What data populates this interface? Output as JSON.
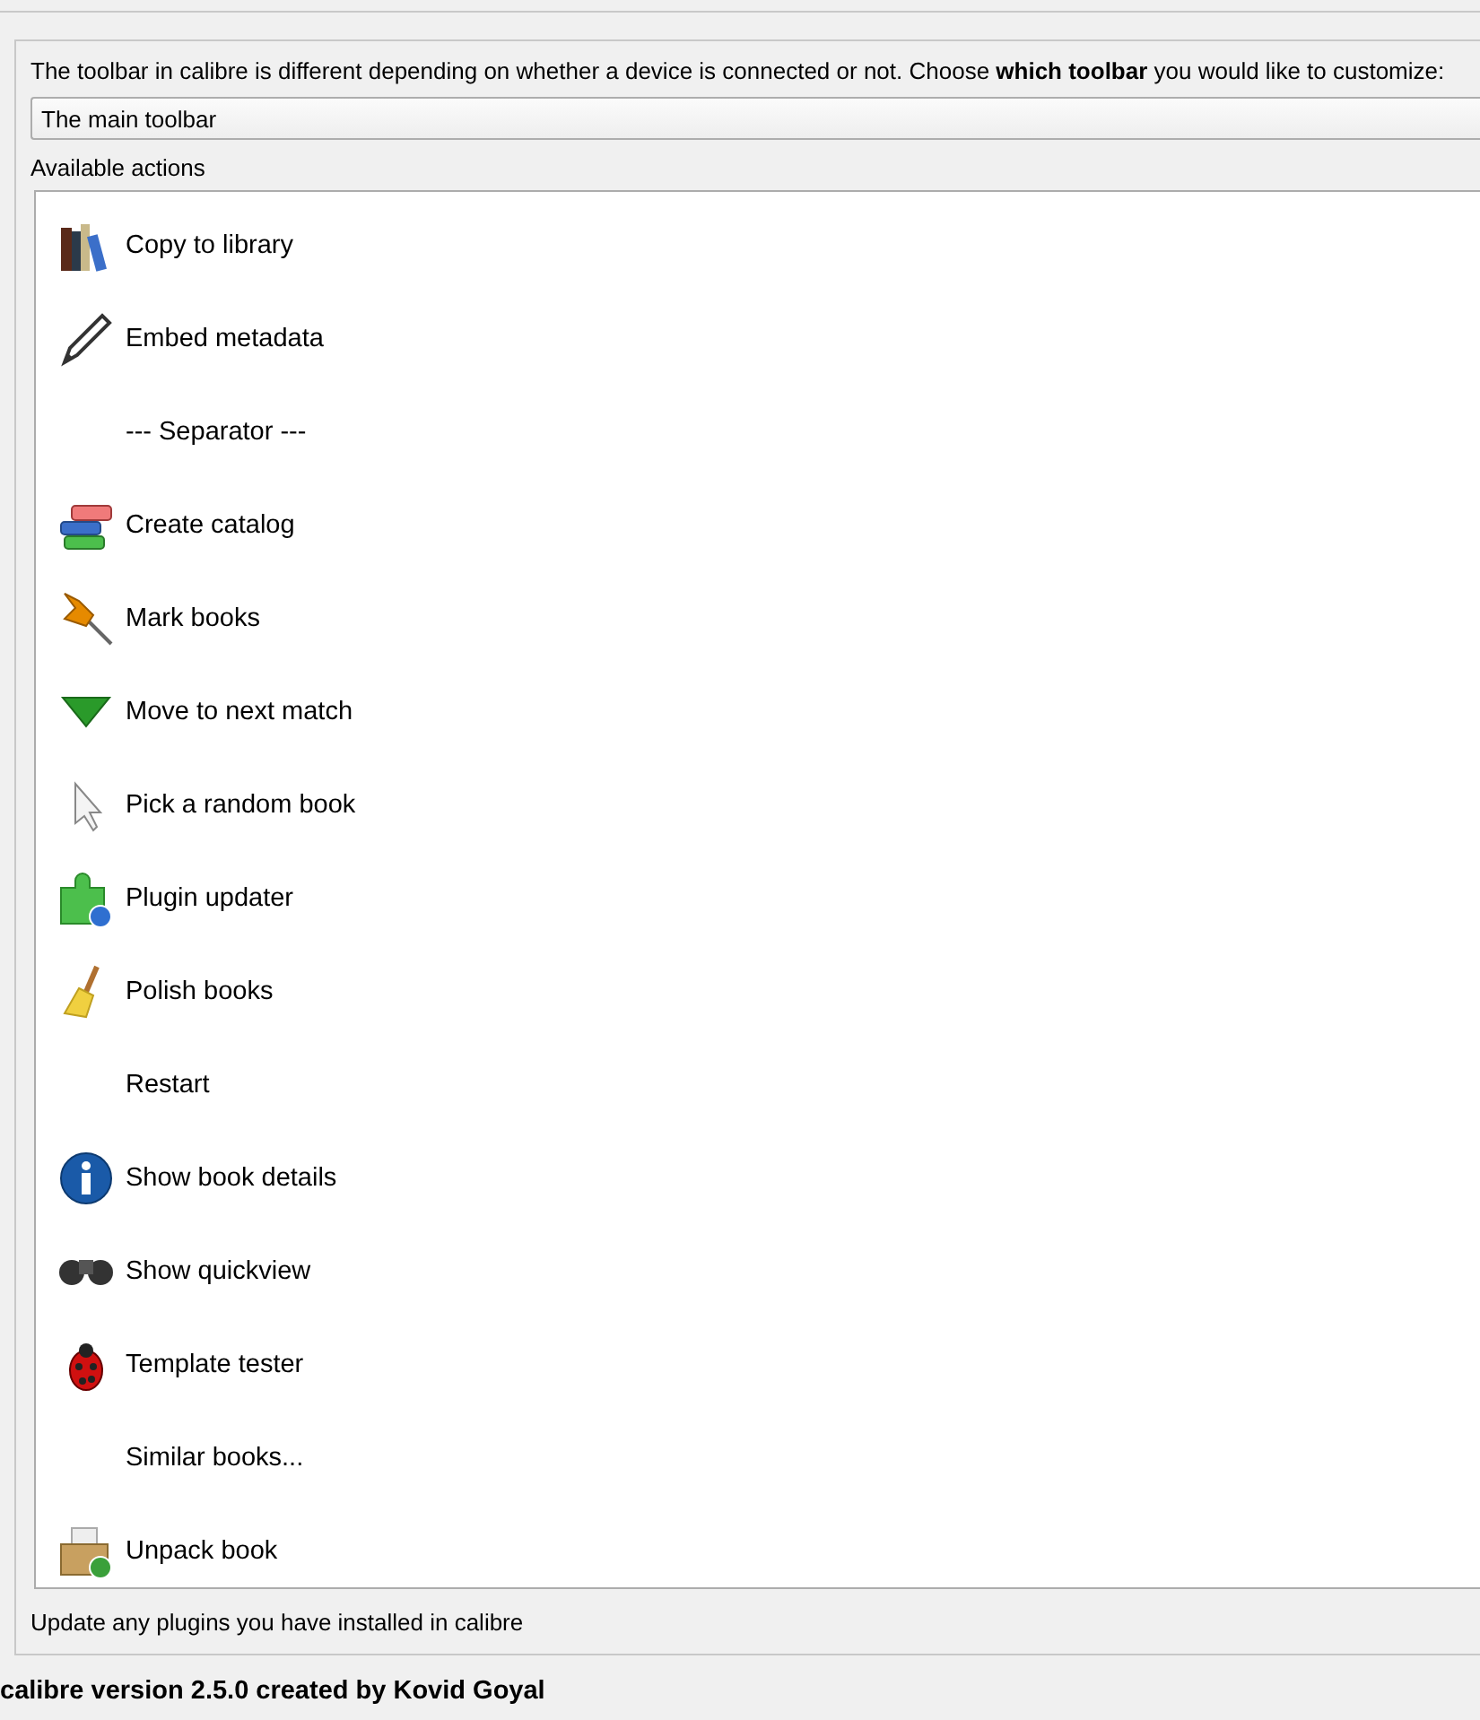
{
  "intro": "The toolbar in calibre is different depending on whether a device is connected or not. Choose **which toolbar** you would like to customize:",
  "toolbar_select": {
    "value": "The main toolbar"
  },
  "available_label": "Available actions",
  "actions": [
    {
      "label": "Copy to library",
      "kind": "books"
    },
    {
      "label": "Embed metadata",
      "kind": "pencil"
    },
    {
      "label": "--- Separator ---",
      "kind": "none"
    },
    {
      "label": "Create catalog",
      "kind": "catalog"
    },
    {
      "label": "Mark books",
      "kind": "pin"
    },
    {
      "label": "Move to next match",
      "kind": "arrow"
    },
    {
      "label": "Pick a random book",
      "kind": "cursor"
    },
    {
      "label": "Plugin updater",
      "kind": "puzzle"
    },
    {
      "label": "Polish books",
      "kind": "broom"
    },
    {
      "label": "Restart",
      "kind": "none"
    },
    {
      "label": "Show book details",
      "kind": "info"
    },
    {
      "label": "Show quickview",
      "kind": "binoculars"
    },
    {
      "label": "Template tester",
      "kind": "bug"
    },
    {
      "label": "Similar books...",
      "kind": "none"
    },
    {
      "label": "Unpack book",
      "kind": "box"
    }
  ],
  "hint": "Update any plugins you have installed in calibre",
  "footer": "calibre version 2.5.0 created by Kovid Goyal"
}
